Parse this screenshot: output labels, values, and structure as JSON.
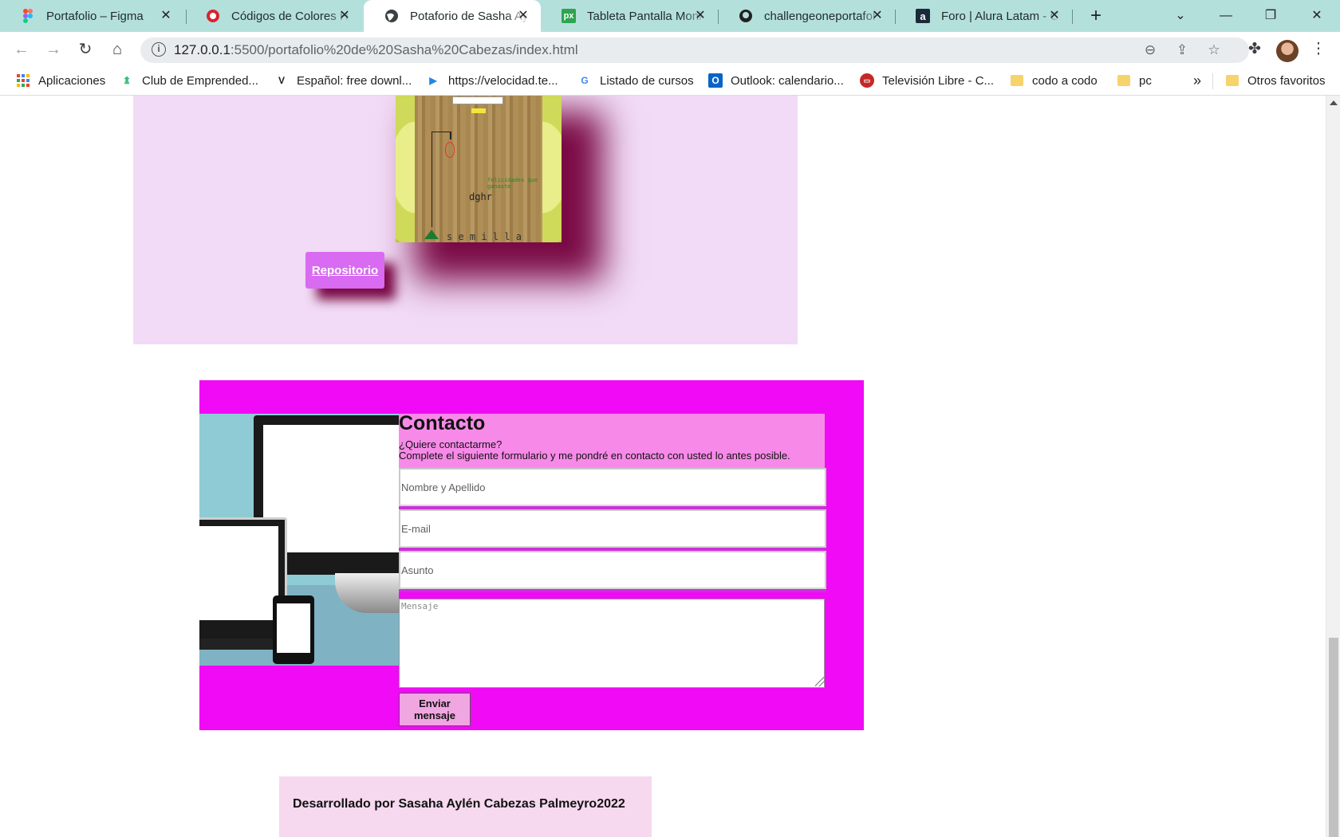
{
  "browser": {
    "tabs": [
      {
        "title": "Portafolio – Figma",
        "icon": "figma-icon",
        "active": false
      },
      {
        "title": "Códigos de Colores H",
        "icon": "color-codes-icon",
        "active": false
      },
      {
        "title": "Potaforio de Sasha Ay",
        "icon": "globe-icon",
        "active": true
      },
      {
        "title": "Tableta Pantalla Moni",
        "icon": "pixabay-icon",
        "active": false
      },
      {
        "title": "challengeoneportafol",
        "icon": "github-icon",
        "active": false
      },
      {
        "title": "Foro | Alura Latam - C",
        "icon": "alura-icon",
        "active": false
      }
    ],
    "url": {
      "host": "127.0.0.1",
      "rest": ":5500/portafolio%20de%20Sasha%20Cabezas/index.html"
    },
    "bookmarks": [
      {
        "label": "Aplicaciones",
        "icon": "apps-grid-icon"
      },
      {
        "label": "Club de Emprended...",
        "icon": "club-icon"
      },
      {
        "label": "Español: free downl...",
        "icon": "v-icon"
      },
      {
        "label": "https://velocidad.te...",
        "icon": "speedtest-icon"
      },
      {
        "label": "Listado de cursos",
        "icon": "google-icon"
      },
      {
        "label": "Outlook: calendario...",
        "icon": "outlook-icon"
      },
      {
        "label": "Televisión Libre - C...",
        "icon": "tv-icon"
      },
      {
        "label": "codo a codo",
        "icon": "folder-icon"
      },
      {
        "label": "pc",
        "icon": "folder-icon"
      }
    ],
    "bookmarks_overflow": "»",
    "other_bookmarks": "Otros favoritos"
  },
  "project": {
    "thumb_text_green": "felicidades que ganaste",
    "thumb_word": "dghr",
    "thumb_bottom": "s e m i l l a",
    "repo_button": "Repositorio"
  },
  "contact": {
    "title": "Contacto",
    "subtitle": "¿Quiere contactarme?",
    "description": "Complete el siguiente formulario y me pondré en contacto con usted lo antes posible.",
    "fields": {
      "name_placeholder": "Nombre y Apellido",
      "email_placeholder": "E-mail",
      "subject_placeholder": "Asunto",
      "message_placeholder": "Mensaje"
    },
    "send_button": "Enviar mensaje"
  },
  "footer": {
    "text": "Desarrollado por Sasaha Aylén Cabezas Palmeyro2022"
  },
  "colors": {
    "tab_strip": "#b4e0dc",
    "project_bg": "#f1dbf6",
    "contact_bg": "#f00af5",
    "contact_header": "#f78ae8",
    "repo_button": "#d86bf1",
    "shadow": "#7a0a45",
    "footer_bg": "#f6d8ef"
  }
}
